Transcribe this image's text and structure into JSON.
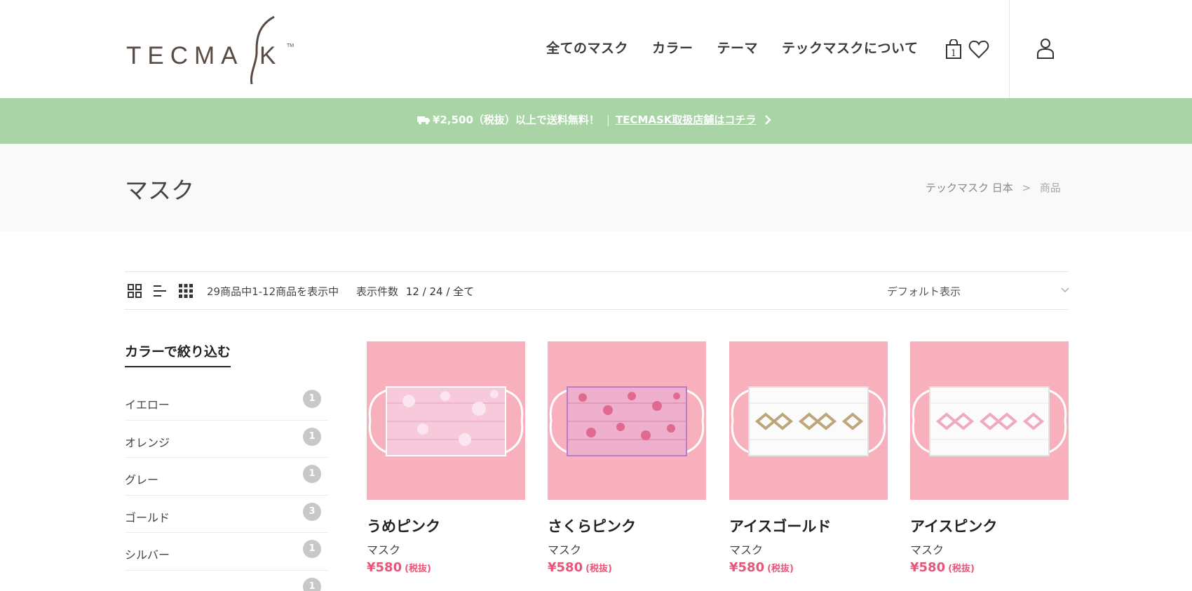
{
  "header": {
    "logo_text": "TECMASK",
    "nav": [
      "全てのマスク",
      "カラー",
      "テーマ",
      "テックマスクについて"
    ],
    "cart_count": "1",
    "icons": [
      "cart-icon",
      "heart-icon",
      "user-icon"
    ]
  },
  "promo": {
    "shipping_text": "¥2,500（税抜）以上で送料無料！",
    "separator": "|",
    "link_text": "TECMASK取扱店舗はコチラ"
  },
  "page": {
    "title": "マスク",
    "breadcrumb": {
      "home": "テックマスク 日本",
      "sep": ">",
      "current": "商品"
    }
  },
  "toolbar": {
    "result_count": "29商品中1-12商品を表示中",
    "per_page_label": "表示件数",
    "per_page_options": "12 / 24 / 全て",
    "sort_selected": "デフォルト表示"
  },
  "sidebar": {
    "title": "カラーで絞り込む",
    "filters": [
      {
        "label": "イエロー",
        "count": "1"
      },
      {
        "label": "オレンジ",
        "count": "1"
      },
      {
        "label": "グレー",
        "count": "1"
      },
      {
        "label": "ゴールド",
        "count": "3"
      },
      {
        "label": "シルバー",
        "count": "1"
      },
      {
        "label": "",
        "count": "1"
      }
    ]
  },
  "products": [
    {
      "name": "うめピンク",
      "category": "マスク",
      "price": "¥580",
      "tax": "(税抜)"
    },
    {
      "name": "さくらピンク",
      "category": "マスク",
      "price": "¥580",
      "tax": "(税抜)"
    },
    {
      "name": "アイスゴールド",
      "category": "マスク",
      "price": "¥580",
      "tax": "(税抜)"
    },
    {
      "name": "アイスピンク",
      "category": "マスク",
      "price": "¥580",
      "tax": "(税抜)"
    }
  ],
  "colors": {
    "promo_bg": "#a9d4a6",
    "price": "#e7577a",
    "product_bg": "#f8b1bc",
    "logo": "#5a4a44"
  }
}
